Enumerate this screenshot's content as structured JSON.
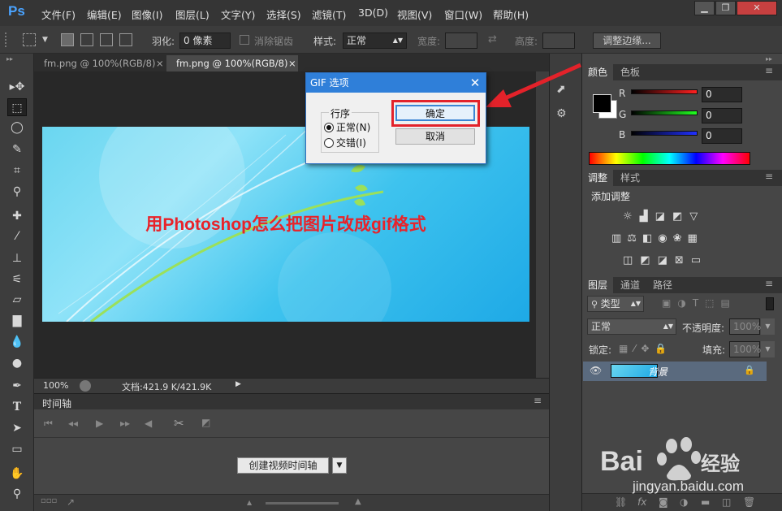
{
  "app": {
    "logo": "Ps"
  },
  "menu": [
    "文件(F)",
    "编辑(E)",
    "图像(I)",
    "图层(L)",
    "文字(Y)",
    "选择(S)",
    "滤镜(T)",
    "3D(D)",
    "视图(V)",
    "窗口(W)",
    "帮助(H)"
  ],
  "window_controls": {
    "minimize": "▁",
    "restore": "❐",
    "close": "✕"
  },
  "options": {
    "feather_label": "羽化:",
    "feather_value": "0 像素",
    "antialias_label": "消除锯齿",
    "style_label": "样式:",
    "style_value": "正常",
    "width_label": "宽度:",
    "height_label": "高度:",
    "refine_edge": "调整边缘..."
  },
  "doc_tabs": [
    {
      "label": "fm.png @ 100%(RGB/8)",
      "close": "×"
    },
    {
      "label": "fm.png @ 100%(RGB/8)",
      "close": "×"
    }
  ],
  "image": {
    "title": "用Photoshop怎么把图片改成gif格式"
  },
  "status": {
    "zoom": "100%",
    "doc_info": "文档:421.9 K/421.9K"
  },
  "timeline": {
    "title": "时间轴",
    "create_button": "创建视频时间轴"
  },
  "color_panel": {
    "tabs": [
      "颜色",
      "色板"
    ],
    "channels": [
      {
        "label": "R",
        "value": "0",
        "color": "#ff2020"
      },
      {
        "label": "G",
        "value": "0",
        "color": "#20ff20"
      },
      {
        "label": "B",
        "value": "0",
        "color": "#2030ff"
      }
    ]
  },
  "adjust_panel": {
    "tabs": [
      "调整",
      "样式"
    ],
    "heading": "添加调整"
  },
  "layers_panel": {
    "tabs": [
      "图层",
      "通道",
      "路径"
    ],
    "filter_kind": "类型",
    "blend_mode": "正常",
    "opacity_label": "不透明度:",
    "opacity_value": "100%",
    "lock_label": "锁定:",
    "fill_label": "填充:",
    "fill_value": "100%",
    "layers": [
      {
        "name": "背景"
      }
    ]
  },
  "dialog": {
    "title": "GIF 选项",
    "close": "✕",
    "group_label": "行序",
    "options": [
      {
        "label": "正常(N)",
        "checked": true
      },
      {
        "label": "交错(I)",
        "checked": false
      }
    ],
    "ok": "确定",
    "cancel": "取消"
  },
  "watermark": {
    "brand": "Bai du 经验",
    "url": "jingyan.baidu.com"
  }
}
